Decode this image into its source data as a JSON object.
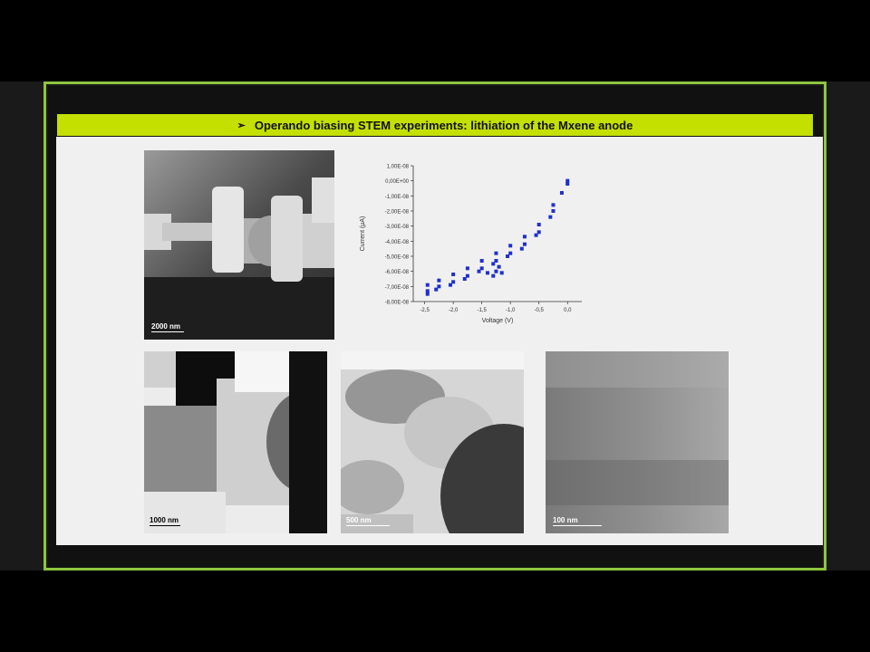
{
  "slide": {
    "title": "Operando biasing STEM experiments: lithiation of the Mxene anode",
    "bullet": "➢",
    "accent_color": "#c3e000",
    "border_color": "#8dc63f"
  },
  "images": [
    {
      "scale_label": "2000 nm"
    },
    {
      "scale_label": "1000 nm"
    },
    {
      "scale_label": "500 nm"
    },
    {
      "scale_label": "100 nm"
    }
  ],
  "chart_data": {
    "type": "scatter",
    "xlabel": "Voltage (V)",
    "ylabel": "Current (µA)",
    "xlim": [
      -2.7,
      0.25
    ],
    "ylim": [
      -8e-08,
      1e-08
    ],
    "x_ticks": [
      "-2,5",
      "-2,0",
      "-1,5",
      "-1,0",
      "-0,5",
      "0,0"
    ],
    "x_tick_values": [
      -2.5,
      -2.0,
      -1.5,
      -1.0,
      -0.5,
      0.0
    ],
    "y_ticks": [
      "1,00E-08",
      "0,00E+00",
      "-1,00E-08",
      "-2,00E-08",
      "-3,00E-08",
      "-4,00E-08",
      "-5,00E-08",
      "-6,00E-08",
      "-7,00E-08",
      "-8,00E-08"
    ],
    "y_tick_values": [
      1e-08,
      0,
      -1e-08,
      -2e-08,
      -3e-08,
      -4e-08,
      -5e-08,
      -6e-08,
      -7e-08,
      -8e-08
    ],
    "marker_color": "#1f2fd0",
    "series": [
      {
        "x": [
          0.0,
          -0.25,
          -0.5,
          -0.75,
          -1.0,
          -1.25,
          -1.5,
          -1.75,
          -2.0,
          -2.25,
          -2.45
        ],
        "y": [
          0,
          -1.6e-08,
          -2.9e-08,
          -3.7e-08,
          -4.3e-08,
          -4.8e-08,
          -5.3e-08,
          -5.8e-08,
          -6.2e-08,
          -6.6e-08,
          -6.9e-08
        ]
      },
      {
        "x": [
          0.0,
          -0.25,
          -0.5,
          -0.75,
          -1.0,
          -1.25,
          -1.5,
          -1.75,
          -2.0,
          -2.25,
          -2.45
        ],
        "y": [
          -2e-09,
          -2e-08,
          -3.4e-08,
          -4.2e-08,
          -4.8e-08,
          -5.3e-08,
          -5.8e-08,
          -6.3e-08,
          -6.7e-08,
          -7e-08,
          -7.3e-08
        ]
      },
      {
        "x": [
          -0.1,
          -0.3,
          -0.55,
          -0.8,
          -1.05,
          -1.3,
          -1.55,
          -1.8,
          -2.05,
          -2.3,
          -2.45
        ],
        "y": [
          -8e-09,
          -2.4e-08,
          -3.6e-08,
          -4.5e-08,
          -5e-08,
          -5.5e-08,
          -6e-08,
          -6.5e-08,
          -6.9e-08,
          -7.2e-08,
          -7.5e-08
        ]
      },
      {
        "x": [
          -1.25,
          -1.2,
          -1.3,
          -1.15,
          -1.4
        ],
        "y": [
          -6e-08,
          -5.7e-08,
          -6.3e-08,
          -6.1e-08,
          -6.1e-08
        ]
      }
    ]
  }
}
